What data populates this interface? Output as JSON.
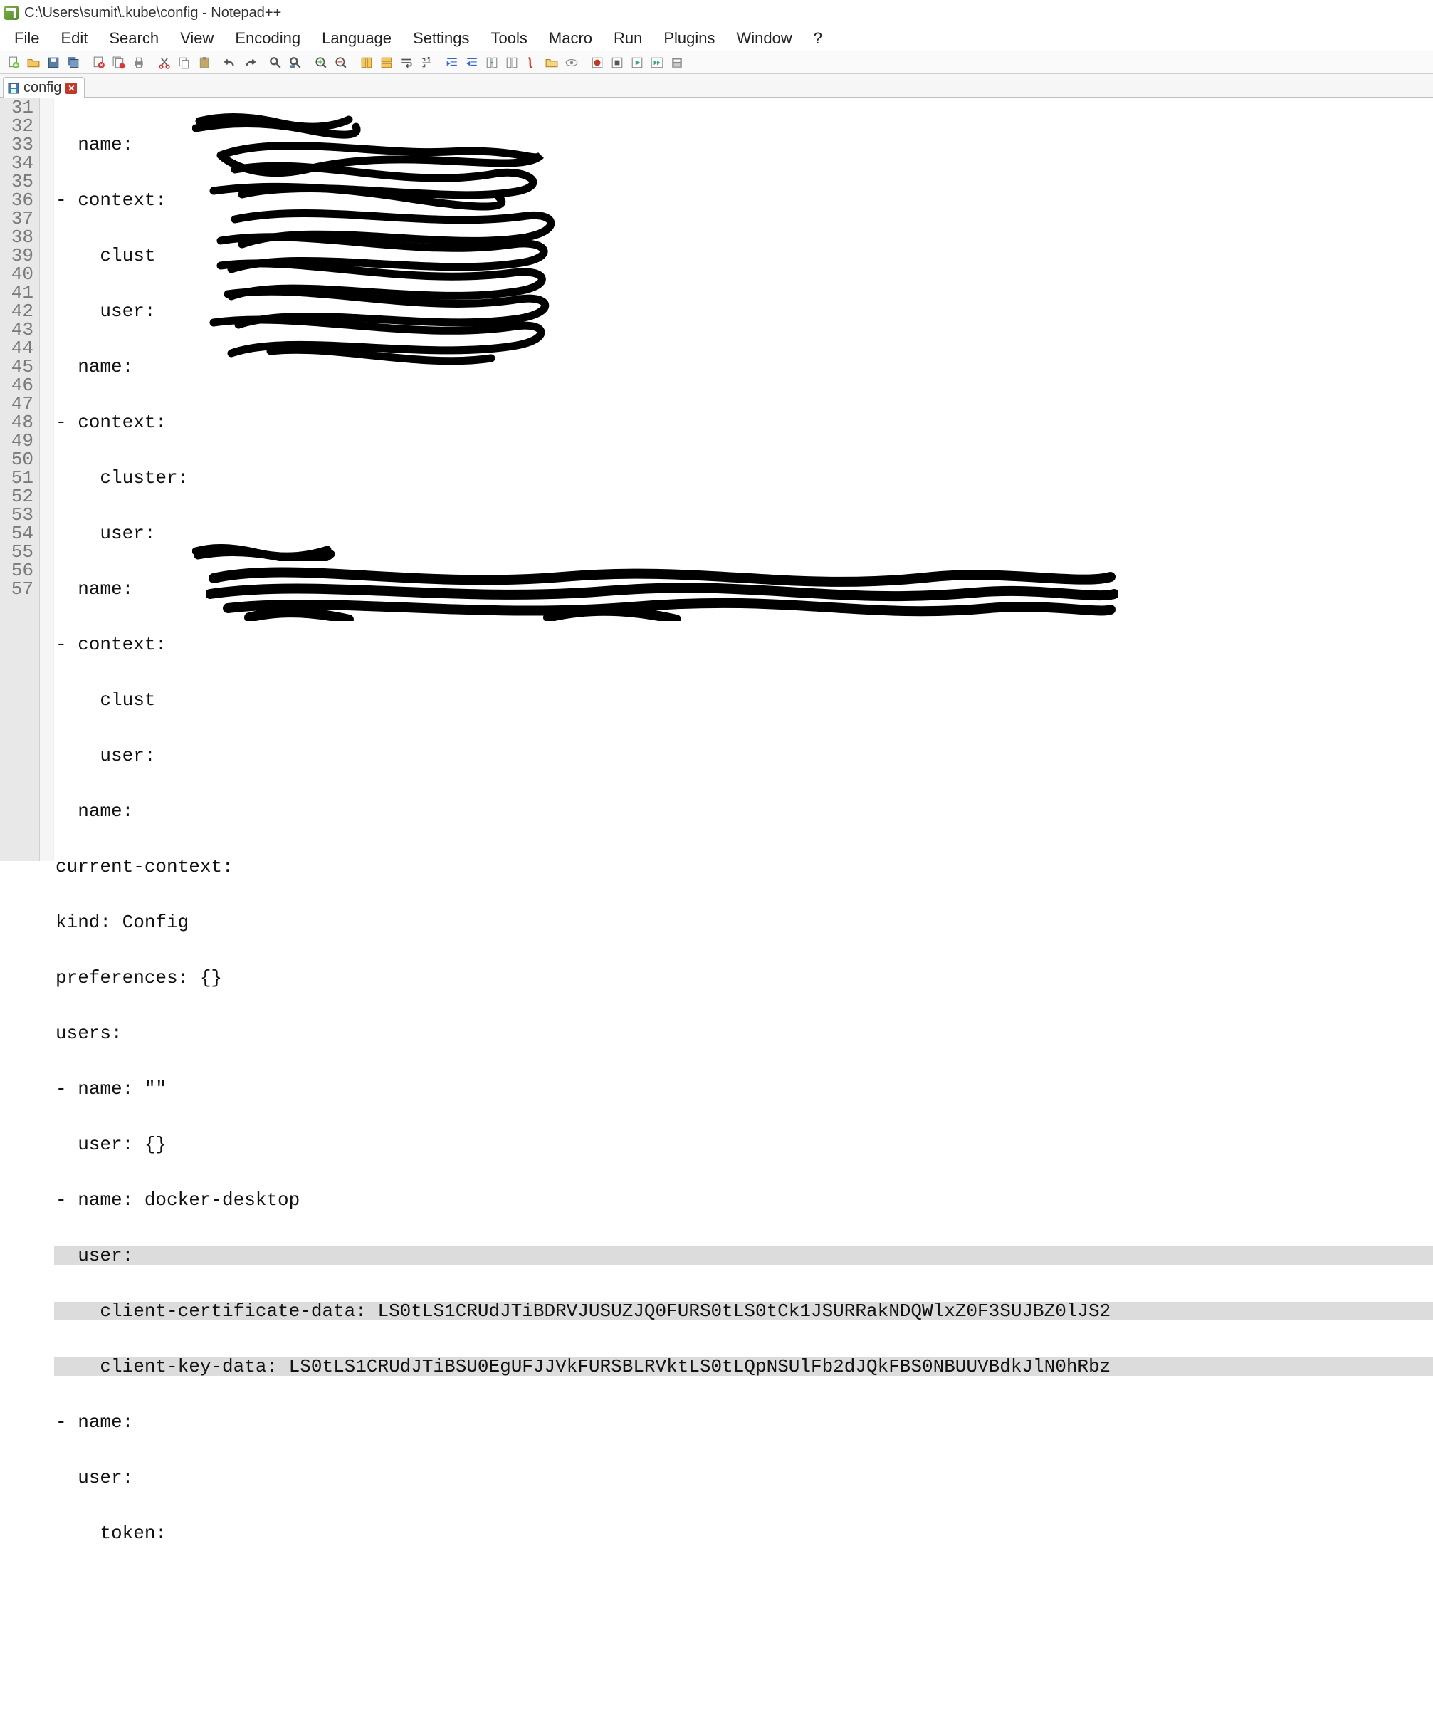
{
  "titlebar": {
    "title": "C:\\Users\\sumit\\.kube\\config - Notepad++"
  },
  "menu": {
    "items": [
      "File",
      "Edit",
      "Search",
      "View",
      "Encoding",
      "Language",
      "Settings",
      "Tools",
      "Macro",
      "Run",
      "Plugins",
      "Window",
      "?"
    ]
  },
  "toolbar": {
    "icons": [
      "new-file",
      "open-file",
      "save",
      "save-all",
      "close",
      "close-all",
      "print",
      "cut",
      "copy",
      "paste",
      "undo",
      "redo",
      "find",
      "replace",
      "zoom-in",
      "zoom-out",
      "sync-v",
      "sync-h",
      "wrap",
      "show-all",
      "indent-guide",
      "folder",
      "user-lang",
      "folder-open",
      "monitor",
      "eye",
      "record",
      "stop",
      "play",
      "fast-forward",
      "settings2"
    ]
  },
  "tab": {
    "label": "config"
  },
  "gutter": {
    "start": 31,
    "end": 57
  },
  "lines": {
    "l31": "  name: ",
    "l32": "- context:",
    "l33": "    clust",
    "l34": "    user:",
    "l35": "  name: ",
    "l36": "- context:",
    "l37": "    cluster: ",
    "l38": "    user:",
    "l39": "  name: ",
    "l40": "- context:",
    "l41": "    clust",
    "l42": "    user:",
    "l43": "  name:",
    "l44": "current-context:",
    "l45": "kind: Config",
    "l46": "preferences: {}",
    "l47": "users:",
    "l48": "- name: \"\"",
    "l49": "  user: {}",
    "l50": "- name: docker-desktop",
    "l51": "  user:",
    "l52": "    client-certificate-data: LS0tLS1CRUdJTiBDRVJUSUZJQ0FURS0tLS0tCk1JSURRakNDQWlxZ0F3SUJBZ0lJS2",
    "l53": "    client-key-data: LS0tLS1CRUdJTiBSU0EgUFJJVkFURSBLRVktLS0tLQpNSUlFb2dJQkFBS0NBUUVBdkJlN0hRbz",
    "l54": "- name: ",
    "l55": "  user:",
    "l56": "    token: ",
    "l57": ""
  }
}
